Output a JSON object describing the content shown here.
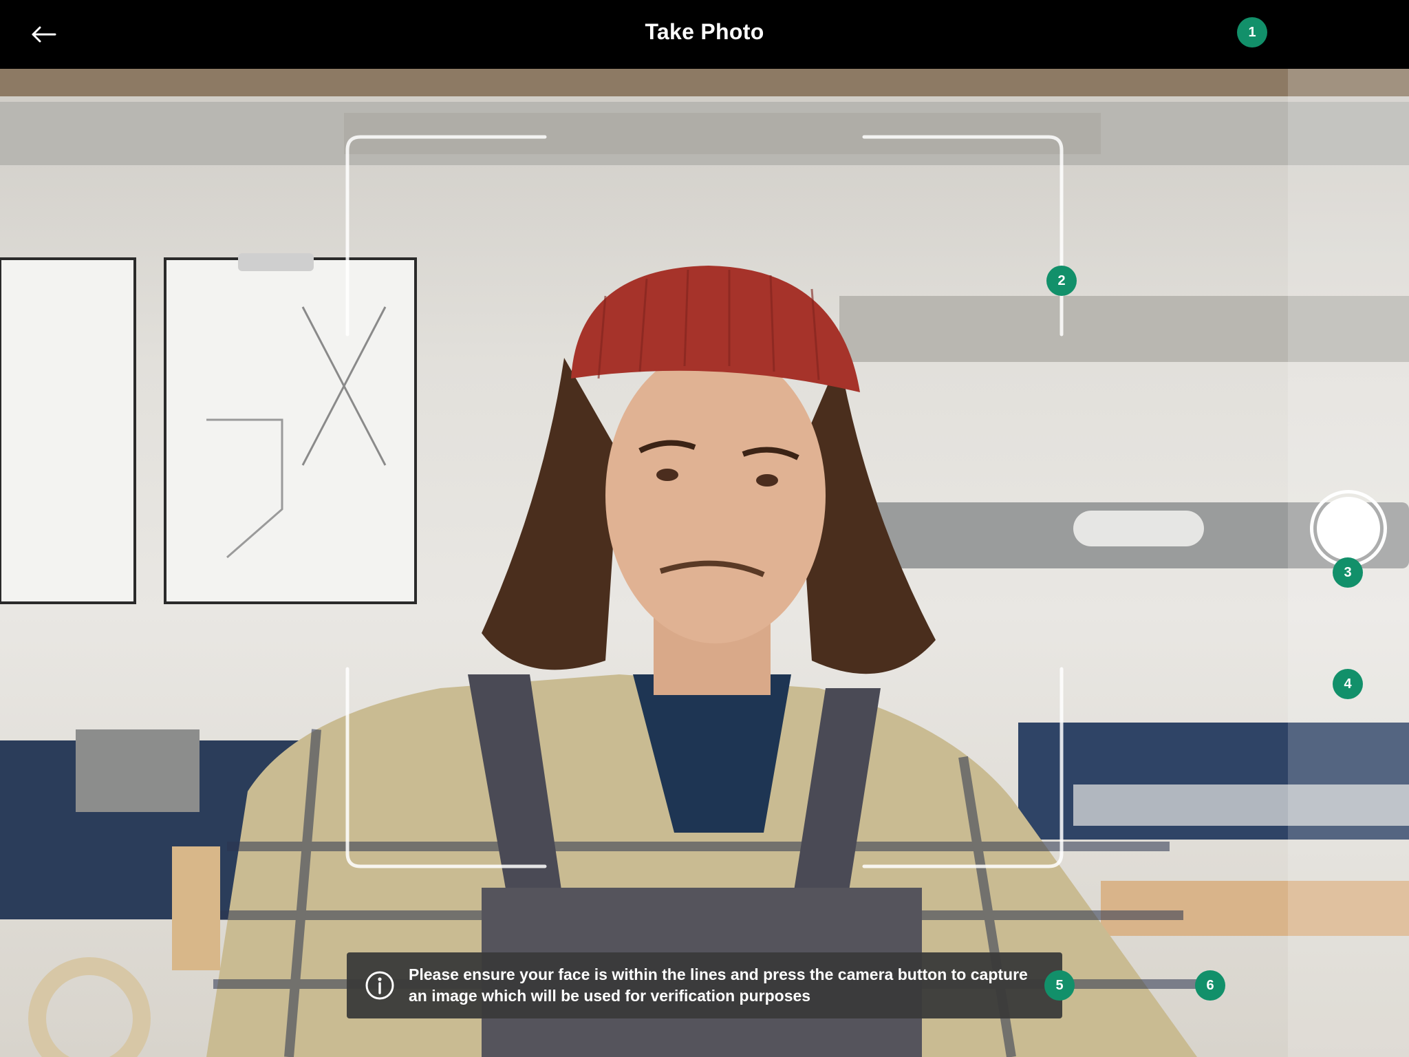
{
  "header": {
    "title": "Take Photo",
    "back_icon": "arrow-left-icon"
  },
  "camera": {
    "shutter_icon": "shutter-button"
  },
  "info_banner": {
    "icon": "info-icon",
    "message": "Please ensure your face is within the lines and press the camera button to capture an image which will be used for verification purposes"
  },
  "markers": [
    "1",
    "2",
    "3",
    "4",
    "5",
    "6"
  ],
  "colors": {
    "header_bg": "#000000",
    "marker_bg": "#12906a",
    "banner_bg": "#3a3a3a",
    "frame_line": "#ffffff"
  }
}
